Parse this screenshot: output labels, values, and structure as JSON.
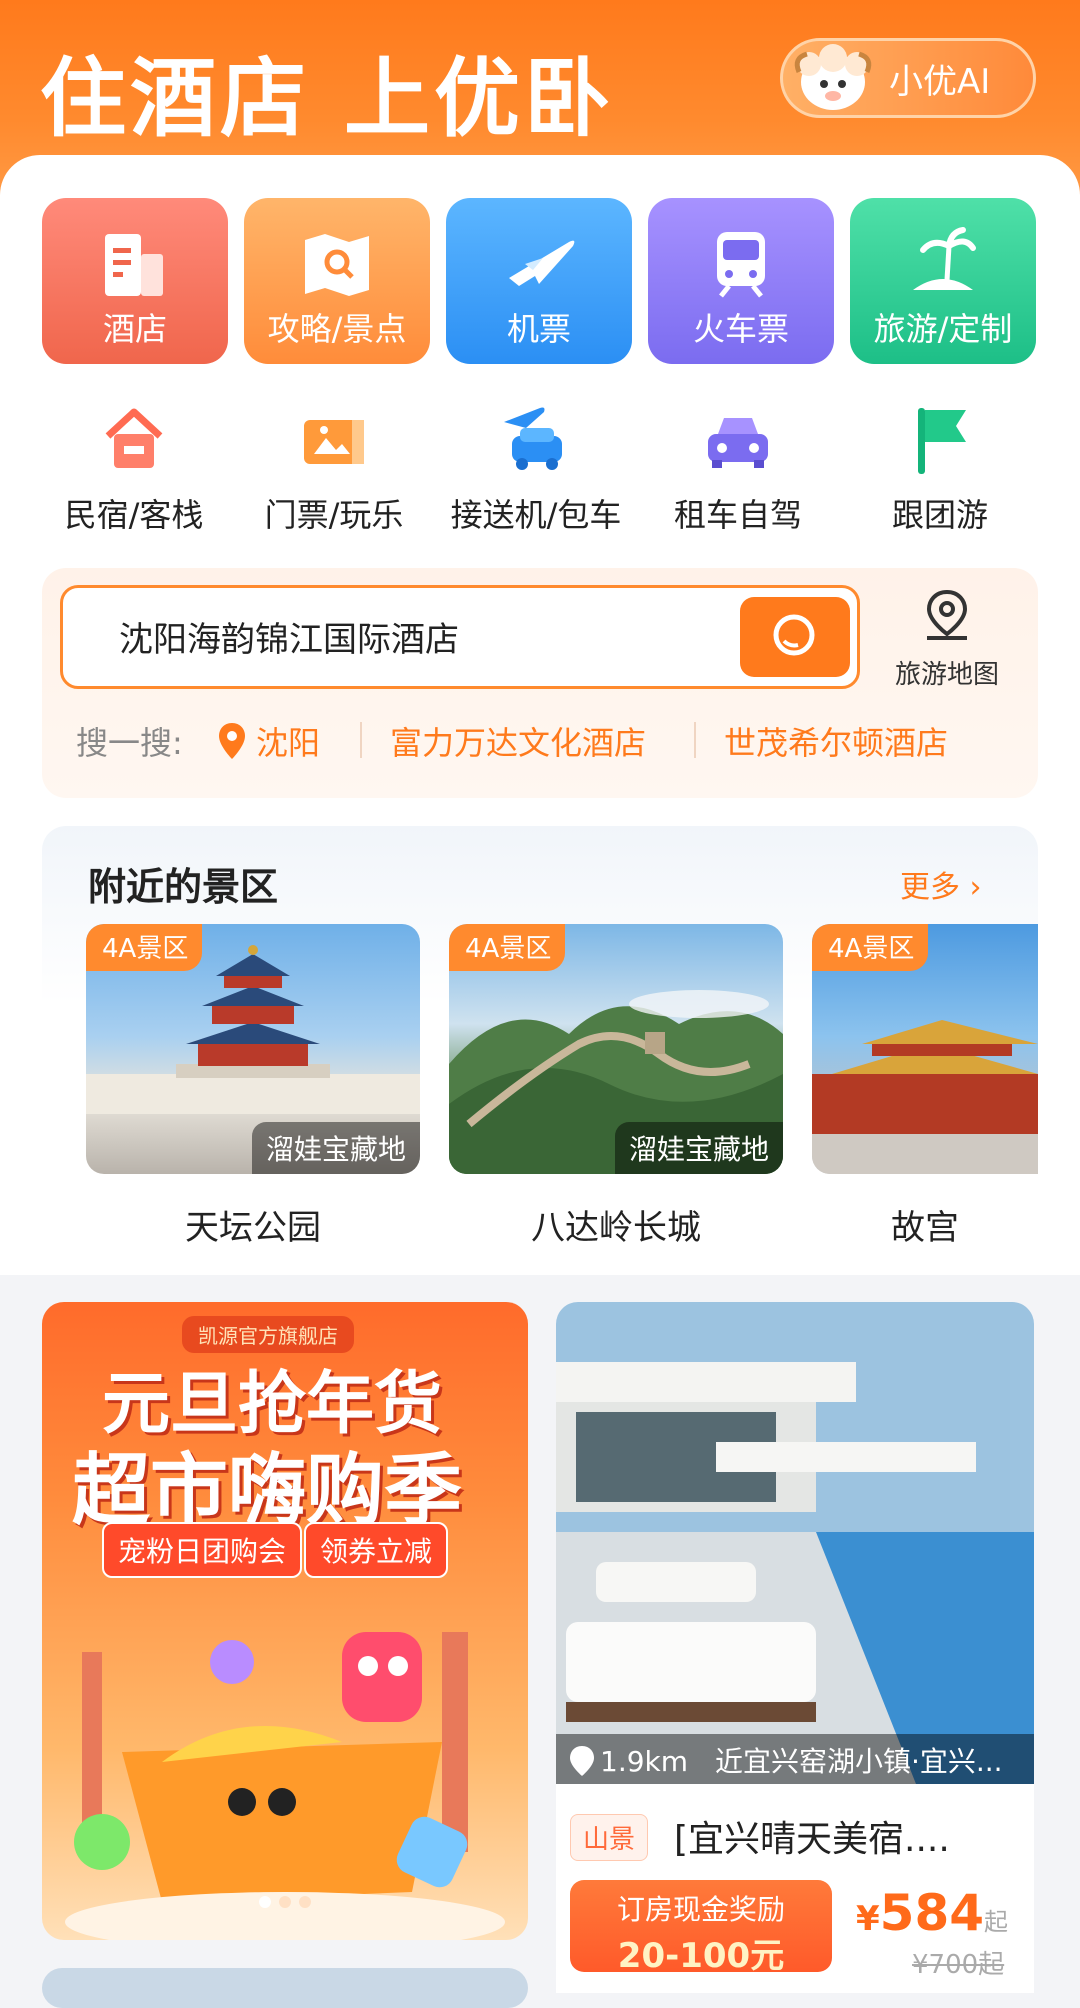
{
  "header": {
    "title": "住酒店 上优卧",
    "ai_label": "小优AI"
  },
  "tiles": [
    {
      "label": "酒店",
      "color_from": "#ff8a7a",
      "color_to": "#f0664c"
    },
    {
      "label": "攻略/景点",
      "color_from": "#ffb56a",
      "color_to": "#ff8c3a"
    },
    {
      "label": "机票",
      "color_from": "#5cb6ff",
      "color_to": "#2b8ff4"
    },
    {
      "label": "火车票",
      "color_from": "#a792ff",
      "color_to": "#7b6cf0"
    },
    {
      "label": "旅游/定制",
      "color_from": "#4fe0a8",
      "color_to": "#1dbf87"
    }
  ],
  "shortcuts": [
    {
      "label": "民宿/客栈",
      "icon": "house-icon"
    },
    {
      "label": "门票/玩乐",
      "icon": "ticket-icon"
    },
    {
      "label": "接送机/包车",
      "icon": "car-plane-icon"
    },
    {
      "label": "租车自驾",
      "icon": "car-icon"
    },
    {
      "label": "跟团游",
      "icon": "flag-icon"
    }
  ],
  "search": {
    "value": "沈阳海韵锦江国际酒店",
    "map_label": "旅游地图",
    "hot_prefix": "搜一搜:",
    "location": "沈阳",
    "hot1": "富力万达文化酒店",
    "hot2": "世茂希尔顿酒店"
  },
  "nearby": {
    "title": "附近的景区",
    "more": "更多",
    "spots": [
      {
        "badge": "4A景区",
        "watermark": "溜娃宝藏地",
        "name": "天坛公园"
      },
      {
        "badge": "4A景区",
        "watermark": "溜娃宝藏地",
        "name": "八达岭长城"
      },
      {
        "badge": "4A景区",
        "watermark": "",
        "name": "故宫"
      }
    ]
  },
  "promo": {
    "store": "凯源官方旗舰店",
    "line1": "元旦抢年货",
    "line2": "超市嗨购季",
    "tag1": "宠粉日团购会",
    "tag2": "领券立减"
  },
  "hotel": {
    "distance": "1.9km",
    "location": "近宜兴窑湖小镇·宜兴...",
    "tag": "山景",
    "title": "[宜兴晴天美宿....",
    "reward_line1": "订房现金奖励",
    "reward_line2": "20-100元",
    "price": "584",
    "price_symbol": "¥",
    "price_suffix": "起",
    "orig_price": "¥700起"
  },
  "colors": {
    "accent": "#ff7a1c",
    "text": "#222222"
  }
}
